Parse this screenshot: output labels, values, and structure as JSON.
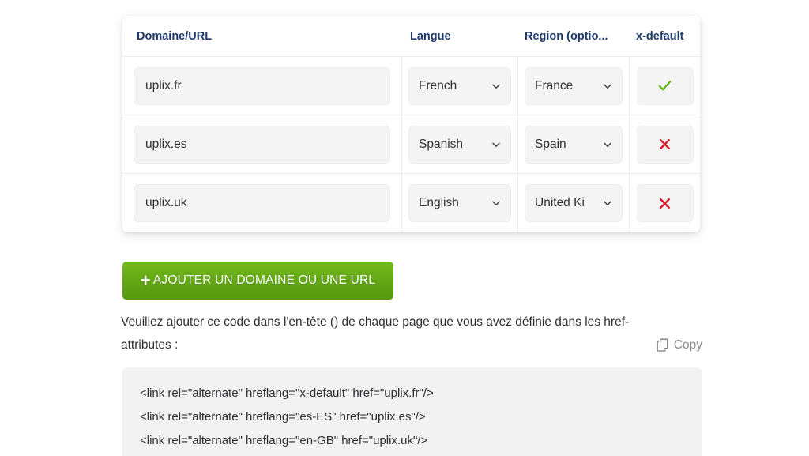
{
  "table": {
    "headers": {
      "domain": "Domaine/URL",
      "language": "Langue",
      "region": "Region (optio...",
      "x_default": "x-default"
    },
    "rows": [
      {
        "domain": "uplix.fr",
        "language": "French",
        "region": "France",
        "x_default": "check",
        "x_default_icon": "check-icon"
      },
      {
        "domain": "uplix.es",
        "language": "Spanish",
        "region": "Spain",
        "x_default": "cross",
        "x_default_icon": "cross-icon"
      },
      {
        "domain": "uplix.uk",
        "language": "English",
        "region": "United Ki",
        "x_default": "cross",
        "x_default_icon": "cross-icon"
      }
    ]
  },
  "add_button": {
    "plus": "+",
    "label": "AJOUTER UN DOMAINE OU UNE URL"
  },
  "instruction": {
    "line1": "Veuillez ajouter ce code dans l'en-tête () de chaque page que vous avez définie dans les href-",
    "line2": "attributes :",
    "copy_label": "Copy",
    "copy_icon": "copy-icon"
  },
  "code_block": {
    "lines": [
      "<link rel=\"alternate\" hreflang=\"x-default\" href=\"uplix.fr\"/>",
      "<link rel=\"alternate\" hreflang=\"es-ES\" href=\"uplix.es\"/>",
      "<link rel=\"alternate\" hreflang=\"en-GB\" href=\"uplix.uk\"/>"
    ]
  },
  "colors": {
    "header_text": "#1e3a6d",
    "check_green": "#5cb415",
    "cross_red": "#d81e2e",
    "button_green": "#62a515",
    "input_bg": "#f4f4f5",
    "code_bg": "#f2f2f3"
  }
}
